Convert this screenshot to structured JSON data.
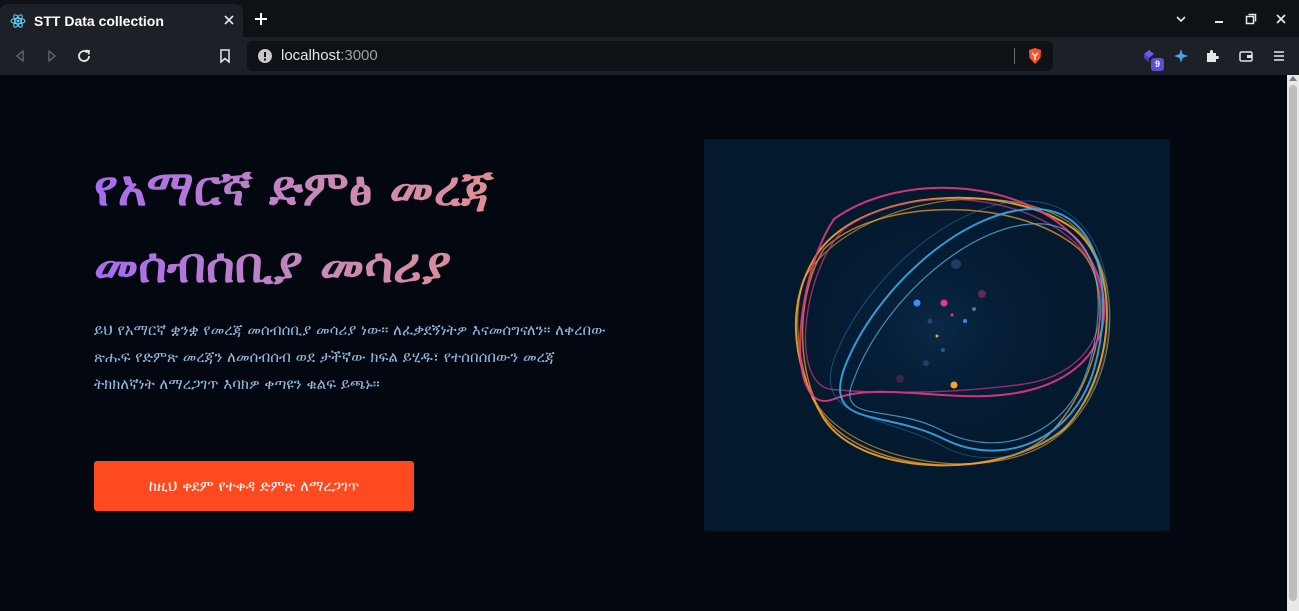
{
  "browser": {
    "tab": {
      "title": "STT Data collection",
      "favicon": "react-icon"
    },
    "url": {
      "host": "localhost",
      "port": ":3000"
    },
    "extensions": {
      "badge_count": "9"
    }
  },
  "hero": {
    "title_line1": "የአማርኛ ድምፅ መረጃ",
    "title_line2": "መሰብሰቢያ መሳሪያ",
    "description": "ይህ የአማርኛ ቋንቋ የመረጃ መሰብሰቢያ መሳሪያ ነው። ለፈቃደኝነትዎ እናመሰግናለን። ለቀረበው ጽሑፍ የድምጽ መረጃን ለመሰብሰብ ወደ ታችኛው ክፍል ይሂዱ፣ የተሰበሰበውን መረጃ ትክክለኛነት ለማረጋገጥ እባክዎ ቀጣዩን ቁልፍ ይጫኑ።",
    "cta_label": "ከዚህ ቀደም የተቀዳ ድምጽ ለማረጋገጥ",
    "art": "abstract-sound-rings-illustration"
  },
  "colors": {
    "page_bg": "#03070f",
    "title_gradient_start": "#a56bf0",
    "title_gradient_end": "#f08f7a",
    "text": "#8fb8e0",
    "cta": "#ff4a1f",
    "art_bg": "#03192e"
  }
}
